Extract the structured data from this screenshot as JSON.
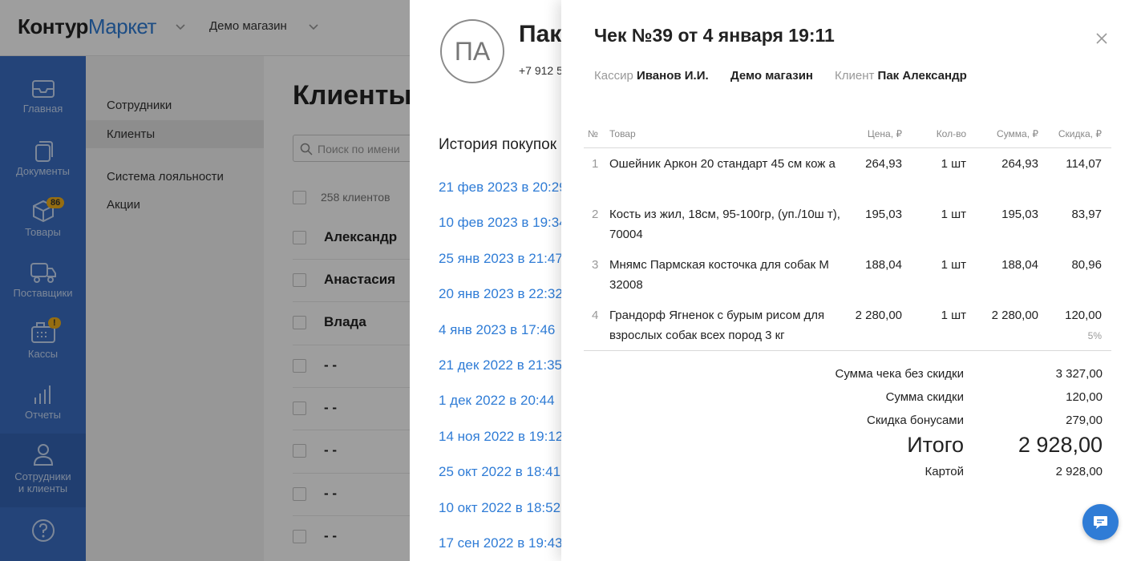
{
  "header": {
    "logo_part1": "Контур",
    "logo_part2": "Маркет",
    "store": "Демо магазин"
  },
  "sidebar": {
    "items": [
      {
        "label": "Главная",
        "icon": "mail-icon"
      },
      {
        "label": "Документы",
        "icon": "documents-icon"
      },
      {
        "label": "Товары",
        "icon": "box-icon",
        "badge": "86"
      },
      {
        "label": "Поставщики",
        "icon": "truck-icon"
      },
      {
        "label": "Кассы",
        "icon": "cash-register-icon",
        "badge": "!"
      },
      {
        "label": "Отчеты",
        "icon": "bar-chart-icon"
      },
      {
        "label": "Сотрудники",
        "label2": "и клиенты",
        "icon": "user-icon"
      },
      {
        "label": "",
        "icon": "help-icon"
      }
    ]
  },
  "subnav": {
    "items": [
      "Сотрудники",
      "Клиенты",
      "Система лояльности",
      "Акции"
    ]
  },
  "clients_page": {
    "title": "Клиенты",
    "search_placeholder": "Поиск по имени",
    "count": "258 клиентов",
    "rows": [
      "Александр",
      "Анастасия",
      "Влада",
      "- -",
      "- -",
      "- -",
      "- -",
      "- -"
    ]
  },
  "client_panel": {
    "initials": "ПА",
    "name": "Пак Александр",
    "phone": "+7 912 5",
    "history_title": "История покупок",
    "history": [
      "21 фев 2023 в 20:29",
      "10 фев 2023 в 19:34",
      "25 янв 2023 в 21:47",
      "20 янв 2023 в 22:32",
      "4 янв 2023 в 17:46",
      "21 дек 2022 в 21:35",
      "1 дек 2022 в 20:44",
      "14 ноя 2022 в 19:12",
      "25 окт 2022 в 18:41",
      "10 окт 2022 в 18:52",
      "17 сен 2022 в 19:43"
    ]
  },
  "receipt": {
    "title": "Чек №39 от 4 января 19:11",
    "cashier_label": "Кассир",
    "cashier": "Иванов И.И.",
    "store": "Демо магазин",
    "client_label": "Клиент",
    "client": "Пак Александр",
    "columns": {
      "num": "№",
      "product": "Товар",
      "price": "Цена, ₽",
      "qty": "Кол-во",
      "sum": "Сумма, ₽",
      "discount": "Скидка, ₽"
    },
    "items": [
      {
        "n": "1",
        "name": "Ошейник Аркон 20 стандарт 45 см кож а",
        "price": "264,93",
        "qty": "1 шт",
        "sum": "264,93",
        "discount": "114,07",
        "discount_note": ""
      },
      {
        "n": "2",
        "name": "Кость из жил, 18см, 95-100гр, (уп./10ш т), 70004",
        "price": "195,03",
        "qty": "1 шт",
        "sum": "195,03",
        "discount": "83,97",
        "discount_note": ""
      },
      {
        "n": "3",
        "name": "Мнямс Пармская косточка для собак М 32008",
        "price": "188,04",
        "qty": "1 шт",
        "sum": "188,04",
        "discount": "80,96",
        "discount_note": ""
      },
      {
        "n": "4",
        "name": "Грандорф Ягненок с бурым рисом для взрослых собак всех пород 3 кг",
        "price": "2 280,00",
        "qty": "1 шт",
        "sum": "2 280,00",
        "discount": "120,00",
        "discount_note": "5%"
      }
    ],
    "totals": {
      "no_discount_label": "Сумма чека без скидки",
      "no_discount": "3 327,00",
      "discount_label": "Сумма скидки",
      "discount": "120,00",
      "bonus_label": "Скидка бонусами",
      "bonus": "279,00",
      "total_label": "Итого",
      "total": "2 928,00",
      "card_label": "Картой",
      "card": "2 928,00"
    }
  }
}
